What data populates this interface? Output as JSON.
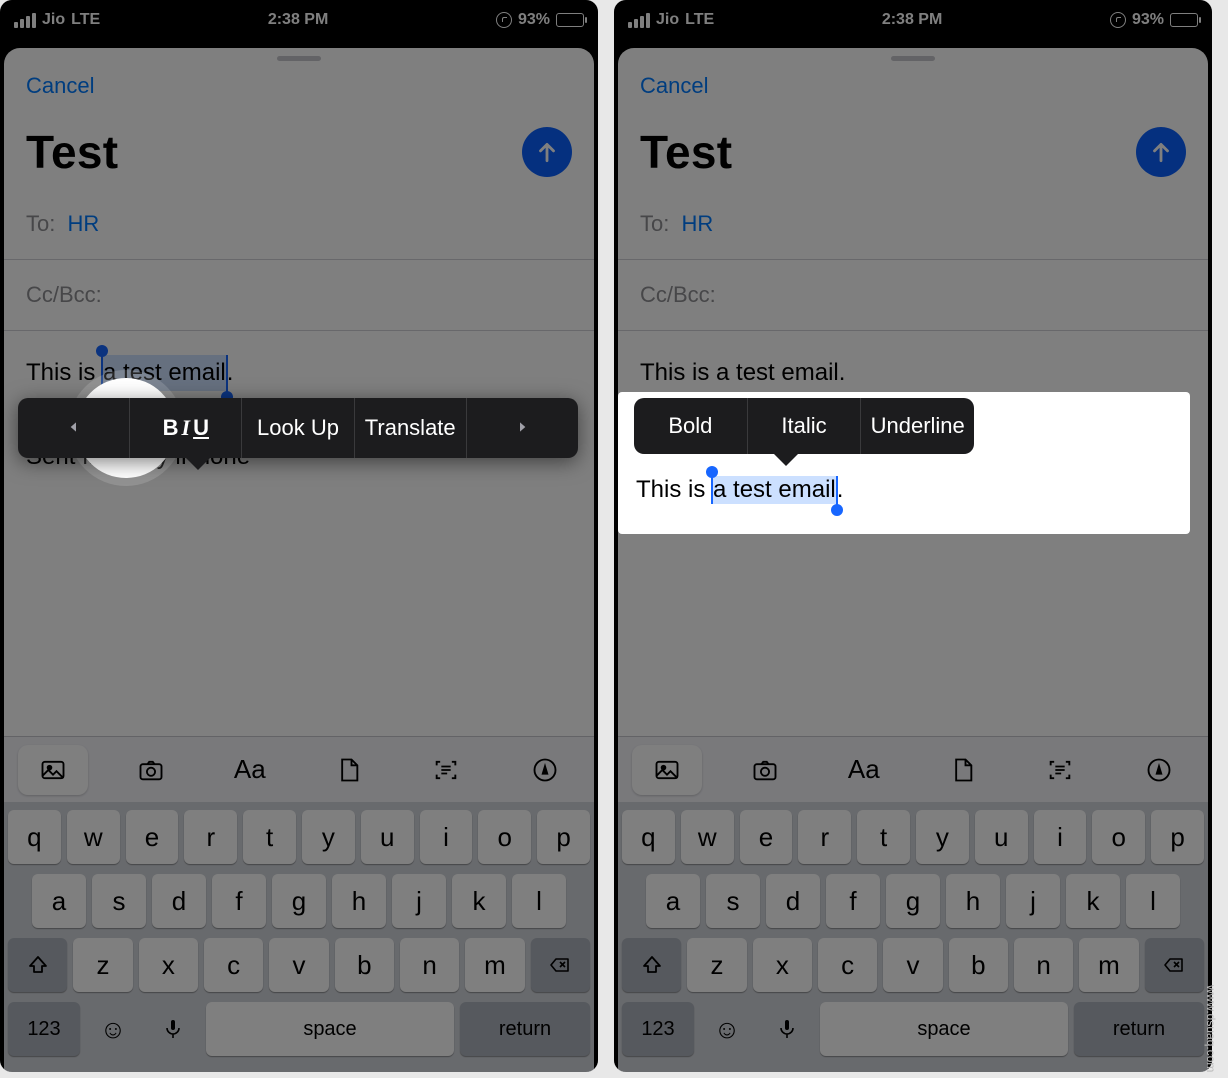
{
  "status": {
    "carrier": "Jio",
    "network": "LTE",
    "time": "2:38 PM",
    "battery_pct": "93%"
  },
  "compose": {
    "cancel": "Cancel",
    "subject": "Test",
    "to_label": "To:",
    "to_value": "HR",
    "ccbcc_label": "Cc/Bcc:",
    "body_prefix": "This is ",
    "body_selected": "a test email",
    "body_suffix": ".",
    "signature": "Sent from my iPhone"
  },
  "menu1": {
    "biu": "BIU",
    "lookup": "Look Up",
    "translate": "Translate"
  },
  "menu2": {
    "bold": "Bold",
    "italic": "Italic",
    "underline": "Underline"
  },
  "formatbar": {
    "aa": "Aa"
  },
  "keyboard": {
    "row1": [
      "q",
      "w",
      "e",
      "r",
      "t",
      "y",
      "u",
      "i",
      "o",
      "p"
    ],
    "row2": [
      "a",
      "s",
      "d",
      "f",
      "g",
      "h",
      "j",
      "k",
      "l"
    ],
    "row3": [
      "z",
      "x",
      "c",
      "v",
      "b",
      "n",
      "m"
    ],
    "numbers": "123",
    "space": "space",
    "return": "return"
  },
  "watermark": "www.dsuaq.com"
}
